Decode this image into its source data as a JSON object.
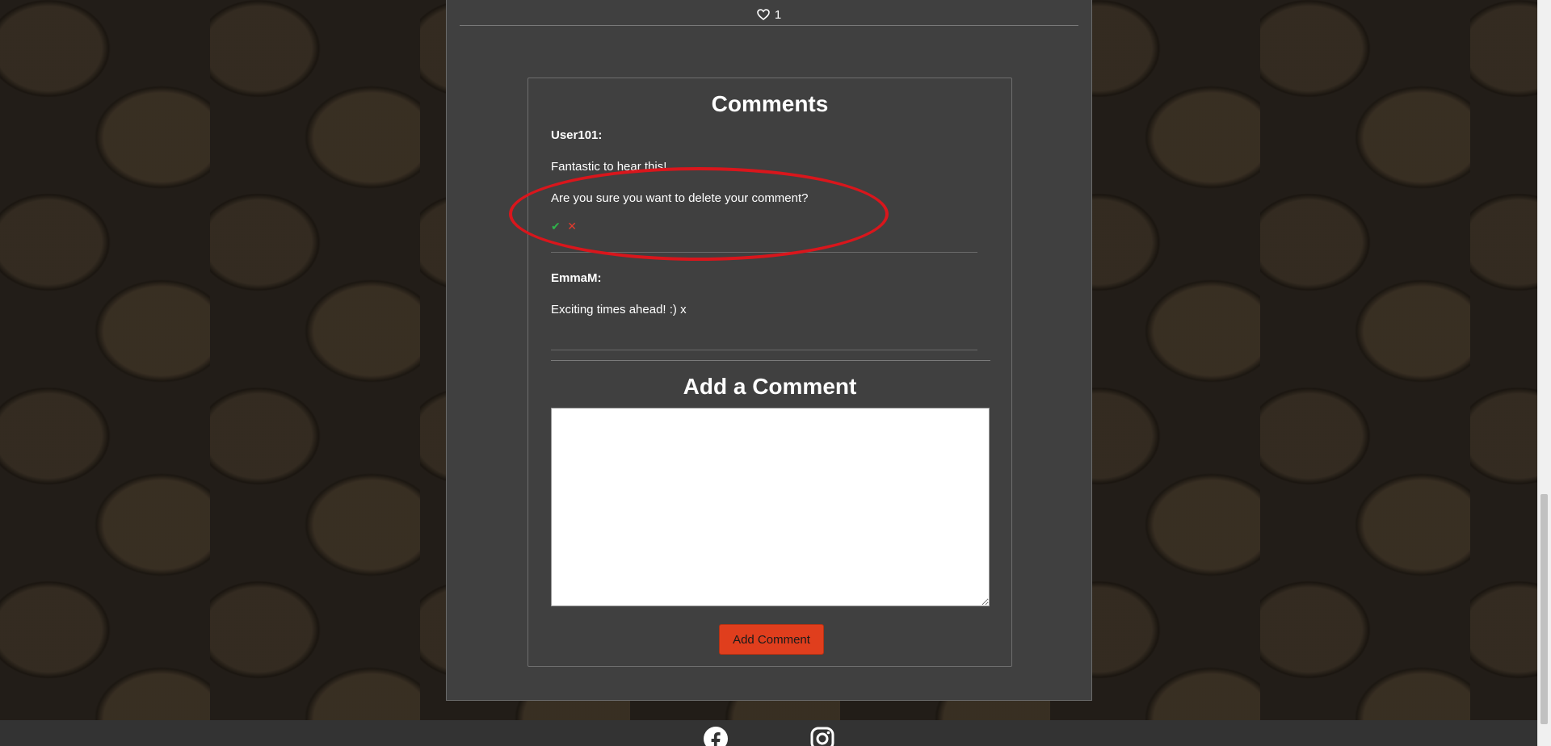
{
  "post": {
    "likes_count": "1"
  },
  "comments_section": {
    "title": "Comments",
    "comments": [
      {
        "author": "User101:",
        "body": "Fantastic to hear this!",
        "confirm_delete": "Are you sure you want to delete your comment?",
        "confirm_yes_icon": "check-icon",
        "confirm_no_icon": "x-icon"
      },
      {
        "author": "EmmaM:",
        "body": "Exciting times ahead! :) x"
      }
    ],
    "highlight_color": "#d9161c"
  },
  "add_comment": {
    "title": "Add a Comment",
    "input_value": "",
    "button_label": "Add Comment",
    "button_color": "#e03e1d"
  },
  "footer": {
    "icons": [
      "facebook-icon",
      "instagram-icon"
    ]
  },
  "colors": {
    "card_bg": "#404040",
    "footer_bg": "#333333",
    "confirm_yes": "#2eb34a",
    "confirm_no": "#e23b2e"
  }
}
